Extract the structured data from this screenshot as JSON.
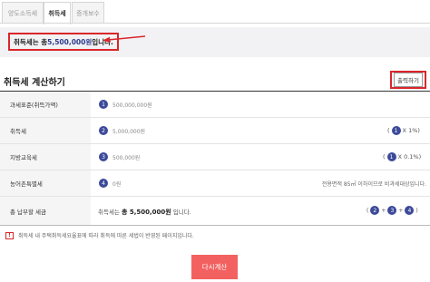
{
  "tabs": [
    {
      "label": "양도소득세",
      "active": false
    },
    {
      "label": "취득세",
      "active": true
    },
    {
      "label": "증개보수",
      "active": false
    }
  ],
  "result": {
    "prefix": "취득세는 총",
    "amount": "5,500,000원",
    "suffix": " 입니다."
  },
  "section": {
    "title": "취득세 계산하기",
    "print_label": "출력하기"
  },
  "rows": [
    {
      "label": "과세표준(취득가액)",
      "num": "1",
      "value": "500,000,000원",
      "rate_open": "",
      "rate_num": "",
      "rate_close": "",
      "note": ""
    },
    {
      "label": "취득세",
      "num": "2",
      "value": "5,000,000원",
      "rate_open": "(",
      "rate_num": "1",
      "rate_close": "X 1%)",
      "note": ""
    },
    {
      "label": "지방교육세",
      "num": "3",
      "value": "500,000원",
      "rate_open": "(",
      "rate_num": "1",
      "rate_close": "X 0.1%)",
      "note": ""
    },
    {
      "label": "농어촌특별세",
      "num": "4",
      "value": "0원",
      "rate_open": "",
      "rate_num": "",
      "rate_close": "",
      "note": "전용면적 85㎡ 이하이므로 비과세대상입니다."
    }
  ],
  "total": {
    "label": "총 납부할 세금",
    "prefix": "취득세는",
    "amount": "총 5,500,000원",
    "suffix": "입니다.",
    "formula": [
      "(",
      "2",
      "+",
      "3",
      "+",
      "4",
      ")"
    ]
  },
  "footnote": "취득세 내 주택취득세요율표에 따라 취득에 따른 세법이 반영된 페이지입니다.",
  "recalc_label": "다시계산",
  "colors": {
    "accent": "#d9262a",
    "badge": "#3c4a9a",
    "button": "#f26160"
  },
  "icons": {
    "warning": "warning-icon",
    "arrow": "left-arrow-icon"
  }
}
